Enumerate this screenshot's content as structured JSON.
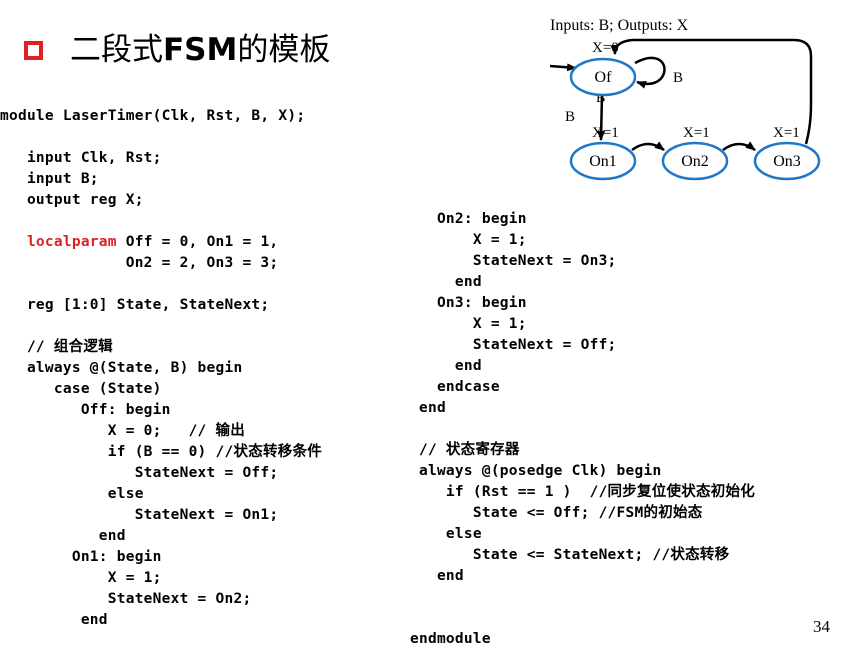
{
  "slide": {
    "title_cn_1": "二段式",
    "title_bold": "FSM",
    "title_cn_2": "的模板",
    "page_number": "34"
  },
  "diagram": {
    "header": "Inputs: B; Outputs: X",
    "states": [
      {
        "name": "Of",
        "output": "X=0"
      },
      {
        "name": "On1",
        "output": "X=1"
      },
      {
        "name": "On2",
        "output": "X=1"
      },
      {
        "name": "On3",
        "output": "X=1"
      }
    ],
    "transitions": {
      "self_loop": "B",
      "off_to_on1_label": "B",
      "off_to_on1_other": "B'"
    },
    "colors": {
      "state_border": "#1f77c9",
      "arrow": "#000000"
    }
  },
  "code_left": [
    "module LaserTimer(Clk, Rst, B, X);",
    "",
    "   input Clk, Rst;",
    "   input B;",
    "   output reg X;",
    "",
    [
      "   ",
      "localparam",
      " Off = 0, On1 = 1,"
    ],
    "              On2 = 2, On3 = 3;",
    "",
    "   reg [1:0] State, StateNext;",
    "",
    "   // 组合逻辑",
    "   always @(State, B) begin",
    "      case (State)",
    "         Off: begin",
    "            X = 0;   // 输出",
    "            if (B == 0) //状态转移条件",
    "               StateNext = Off;",
    "            else",
    "               StateNext = On1;",
    "           end",
    "        On1: begin",
    "            X = 1;",
    "            StateNext = On2;",
    "         end"
  ],
  "code_right": [
    "   On2: begin",
    "       X = 1;",
    "       StateNext = On3;",
    "     end",
    "   On3: begin",
    "       X = 1;",
    "       StateNext = Off;",
    "     end",
    "   endcase",
    " end",
    "",
    " // 状态寄存器",
    " always @(posedge Clk) begin",
    "    if (Rst == 1 )  //同步复位使状态初始化",
    "       State <= Off; //FSM的初始态",
    "    else",
    "       State <= StateNext; //状态转移",
    "   end",
    "",
    "",
    "endmodule"
  ]
}
